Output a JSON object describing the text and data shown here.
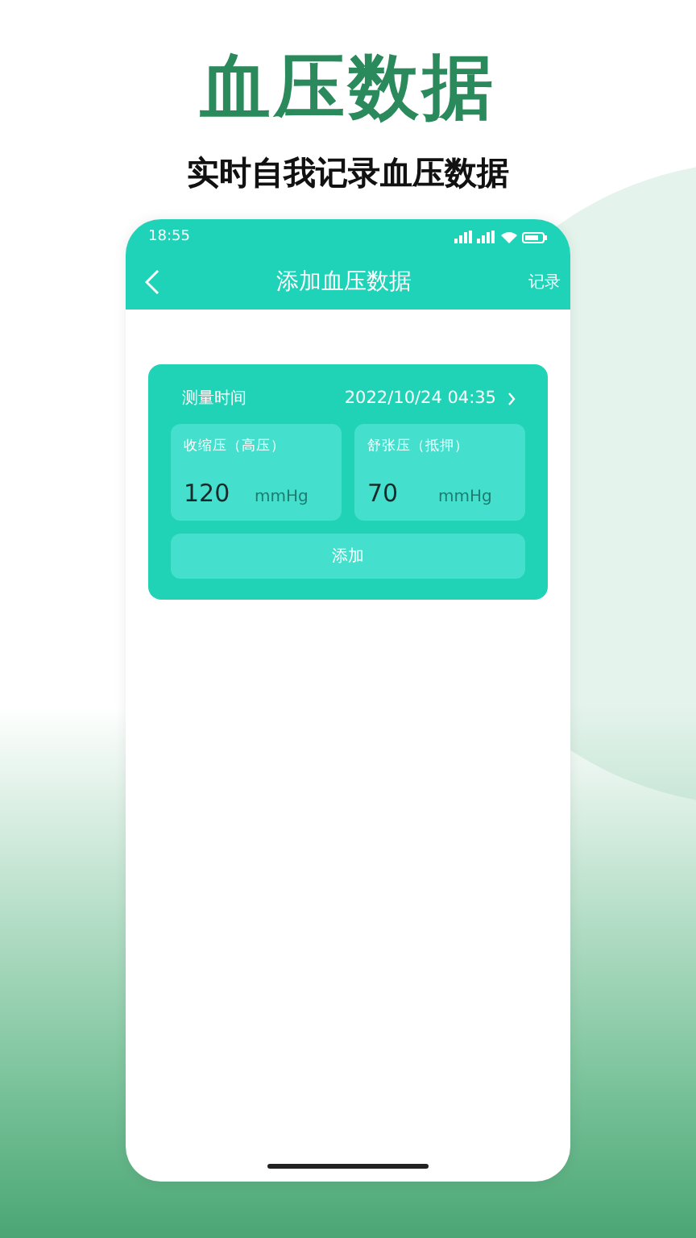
{
  "headline": "血压数据",
  "subtitle": "实时自我记录血压数据",
  "status_bar": {
    "time": "18:55"
  },
  "nav": {
    "title": "添加血压数据",
    "action": "记录"
  },
  "form": {
    "time_label": "测量时间",
    "time_value": "2022/10/24 04:35",
    "fields": [
      {
        "label": "收缩压（高压）",
        "value": "120",
        "unit": "mmHg"
      },
      {
        "label": "舒张压（抵押）",
        "value": "70",
        "unit": "mmHg"
      }
    ],
    "submit": "添加"
  }
}
